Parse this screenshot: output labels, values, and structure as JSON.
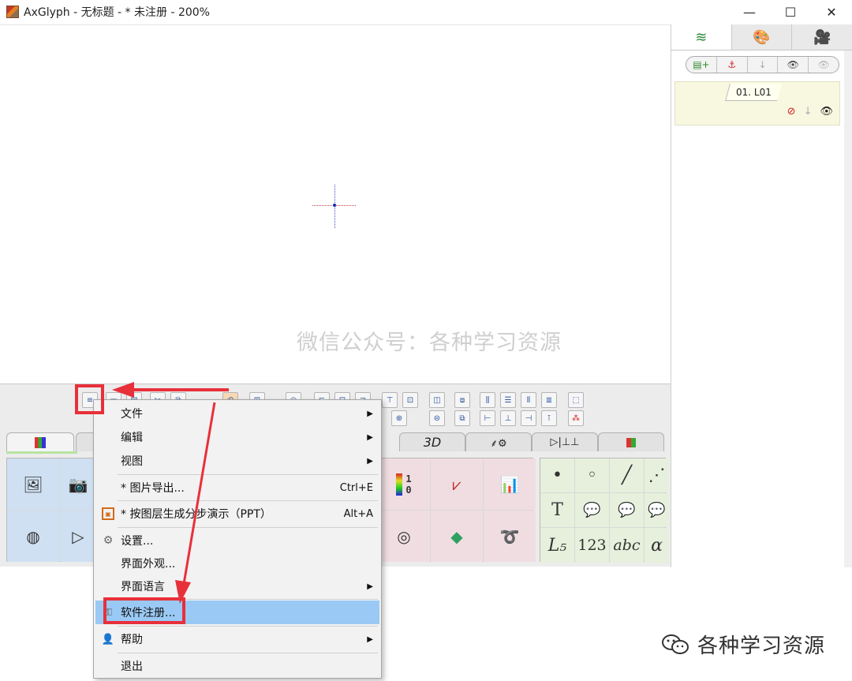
{
  "window": {
    "title": "AxGlyph - 无标题 - * 未注册 - 200%",
    "controls": {
      "minimize": "—",
      "maximize": "☐",
      "close": "✕"
    }
  },
  "canvas": {
    "watermark": "微信公众号：各种学习资源"
  },
  "tabs": [
    {
      "label": ""
    },
    {
      "label": ""
    },
    {
      "label": "3D"
    },
    {
      "label": "⸙⚙"
    },
    {
      "label": "▷|⊥⊥"
    },
    {
      "label": ""
    }
  ],
  "shapes_panel": {
    "row1": [
      "•",
      "◦",
      "╱",
      "⋰"
    ],
    "row2": [
      "T",
      "💬",
      "💬",
      "💬"
    ],
    "row3": [
      "L₅",
      "123",
      "abc",
      "α"
    ]
  },
  "chart_panel": {
    "colorbar_label_top": "1",
    "colorbar_label_bottom": "0"
  },
  "right_panel": {
    "layer_name": "01. L01"
  },
  "menu": {
    "items": [
      {
        "label": "文件",
        "shortcut": "",
        "has_submenu": true
      },
      {
        "label": "编辑",
        "shortcut": "",
        "has_submenu": true
      },
      {
        "label": "视图",
        "shortcut": "",
        "has_submenu": true
      },
      {
        "label": "* 图片导出...",
        "shortcut": "Ctrl+E",
        "has_submenu": false
      },
      {
        "label": "* 按图层生成分步演示（PPT）",
        "shortcut": "Alt+A",
        "has_submenu": false
      },
      {
        "label": "设置...",
        "shortcut": "",
        "has_submenu": false
      },
      {
        "label": "界面外观...",
        "shortcut": "",
        "has_submenu": false
      },
      {
        "label": "界面语言",
        "shortcut": "",
        "has_submenu": true
      },
      {
        "label": "软件注册...",
        "shortcut": "",
        "has_submenu": false
      },
      {
        "label": "帮助",
        "shortcut": "",
        "has_submenu": true
      },
      {
        "label": "退出",
        "shortcut": "",
        "has_submenu": false
      }
    ],
    "submenu_arrow": "▶"
  },
  "bottom_watermark": "各种学习资源",
  "colors": {
    "annotation_red": "#e8303a",
    "menu_highlight": "#99c9f4",
    "layer_bg": "#f8f8e0"
  }
}
